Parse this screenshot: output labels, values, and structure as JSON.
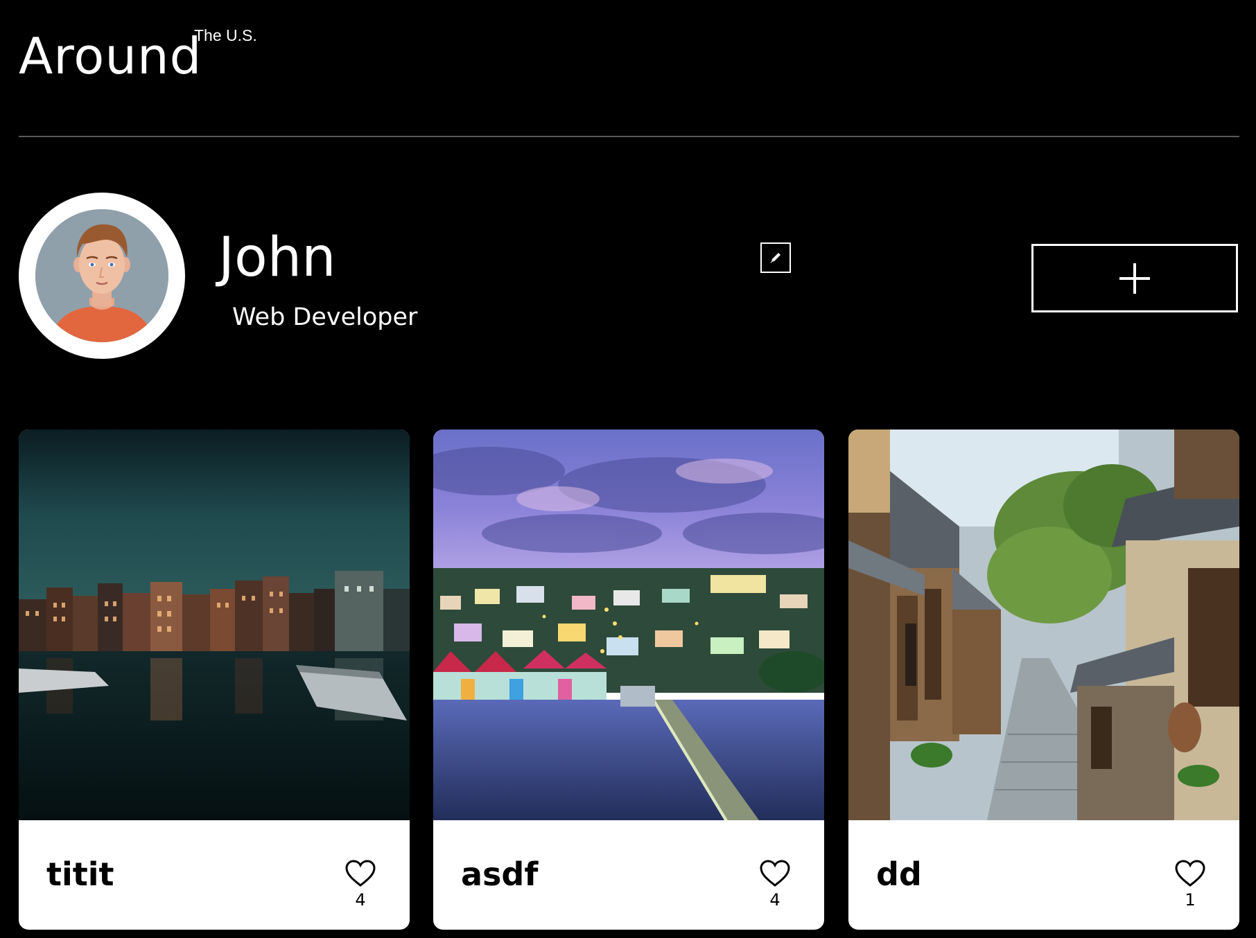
{
  "header": {
    "logo_main": "Around",
    "logo_sup": "The U.S."
  },
  "profile": {
    "name": "John",
    "job": "Web Developer",
    "avatar_icon": "avatar-illustration",
    "edit_icon": "pencil-icon",
    "add_icon": "plus-icon"
  },
  "cards": [
    {
      "title": "titit",
      "likes": "4",
      "image": "amsterdam-canal-night"
    },
    {
      "title": "asdf",
      "likes": "4",
      "image": "harbor-town-dusk"
    },
    {
      "title": "dd",
      "likes": "1",
      "image": "kyoto-street"
    }
  ],
  "colors": {
    "background": "#000000",
    "card_background": "#ffffff",
    "divider": "#5a5a5a"
  }
}
